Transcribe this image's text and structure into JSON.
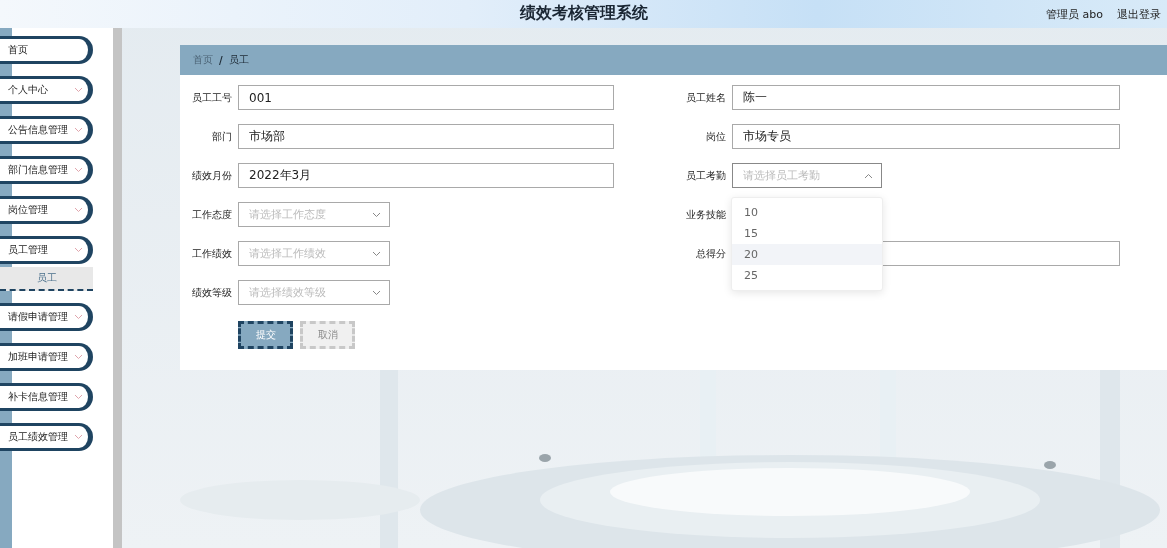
{
  "header": {
    "title": "绩效考核管理系统",
    "user": "管理员 abo",
    "logout": "退出登录"
  },
  "sidebar": {
    "items": [
      {
        "label": "首页",
        "kind": "link"
      },
      {
        "label": "个人中心",
        "kind": "submenu"
      },
      {
        "label": "公告信息管理",
        "kind": "submenu"
      },
      {
        "label": "部门信息管理",
        "kind": "submenu"
      },
      {
        "label": "岗位管理",
        "kind": "submenu"
      },
      {
        "label": "员工管理",
        "kind": "submenu",
        "children": [
          {
            "label": "员工",
            "selected": true
          }
        ]
      },
      {
        "label": "请假申请管理",
        "kind": "submenu"
      },
      {
        "label": "加班申请管理",
        "kind": "submenu"
      },
      {
        "label": "补卡信息管理",
        "kind": "submenu"
      },
      {
        "label": "员工绩效管理",
        "kind": "submenu"
      }
    ]
  },
  "breadcrumb": {
    "items": [
      "首页",
      "员工"
    ],
    "separator": "/"
  },
  "form": {
    "fields": [
      {
        "label": "员工工号",
        "kind": "input",
        "value": "001"
      },
      {
        "label": "员工姓名",
        "kind": "input",
        "value": "陈一"
      },
      {
        "label": "部门",
        "kind": "input",
        "value": "市场部"
      },
      {
        "label": "岗位",
        "kind": "input",
        "value": "市场专员"
      },
      {
        "label": "绩效月份",
        "kind": "input",
        "value": "2022年3月"
      },
      {
        "label": "员工考勤",
        "kind": "select",
        "placeholder": "请选择员工考勤",
        "open": true,
        "options": [
          {
            "label": "10",
            "hovered": false
          },
          {
            "label": "15",
            "hovered": false
          },
          {
            "label": "20",
            "hovered": true
          },
          {
            "label": "25",
            "hovered": false
          }
        ]
      },
      {
        "label": "工作态度",
        "kind": "select",
        "placeholder": "请选择工作态度",
        "open": false
      },
      {
        "label": "业务技能",
        "kind": "covered"
      },
      {
        "label": "工作绩效",
        "kind": "select",
        "placeholder": "请选择工作绩效",
        "open": false
      },
      {
        "label": "总得分",
        "kind": "input"
      },
      {
        "label": "绩效等级",
        "kind": "select",
        "placeholder": "请选择绩效等级",
        "open": false
      }
    ],
    "buttons": [
      {
        "label": "提交",
        "kind": "primary"
      },
      {
        "label": "取消",
        "kind": "cancel"
      }
    ]
  }
}
